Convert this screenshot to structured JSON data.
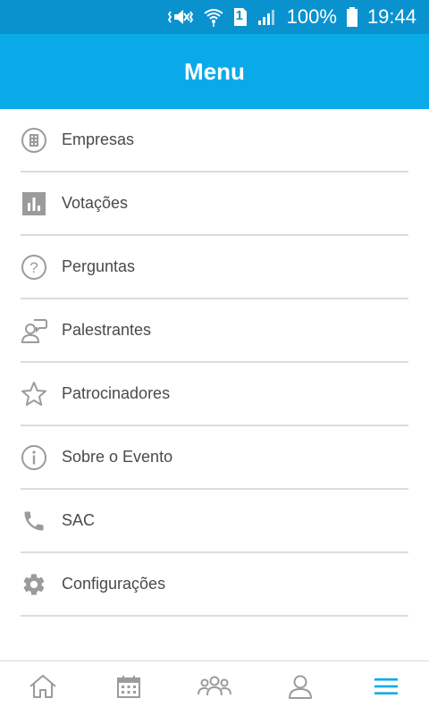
{
  "status_bar": {
    "battery": "100%",
    "time": "19:44",
    "sim_slot": "1",
    "icons": [
      "mute-vibrate-icon",
      "wifi-icon",
      "sim-icon",
      "signal-icon",
      "battery-icon"
    ]
  },
  "header": {
    "title": "Menu"
  },
  "colors": {
    "header": "#0aaae8",
    "status_bar": "#0a92cf",
    "icon_gray": "#9b9b9b",
    "active_tab": "#0aaae8"
  },
  "menu": {
    "items": [
      {
        "label": "Empresas",
        "icon": "building-icon"
      },
      {
        "label": "Votações",
        "icon": "bar-chart-icon"
      },
      {
        "label": "Perguntas",
        "icon": "question-icon"
      },
      {
        "label": "Palestrantes",
        "icon": "speaker-icon"
      },
      {
        "label": "Patrocinadores",
        "icon": "star-icon"
      },
      {
        "label": "Sobre o Evento",
        "icon": "info-icon"
      },
      {
        "label": "SAC",
        "icon": "phone-icon"
      },
      {
        "label": "Configurações",
        "icon": "gear-icon"
      }
    ]
  },
  "tab_bar": {
    "tabs": [
      {
        "icon": "home-icon",
        "active": false
      },
      {
        "icon": "calendar-icon",
        "active": false
      },
      {
        "icon": "people-icon",
        "active": false
      },
      {
        "icon": "profile-icon",
        "active": false
      },
      {
        "icon": "hamburger-menu-icon",
        "active": true
      }
    ]
  }
}
